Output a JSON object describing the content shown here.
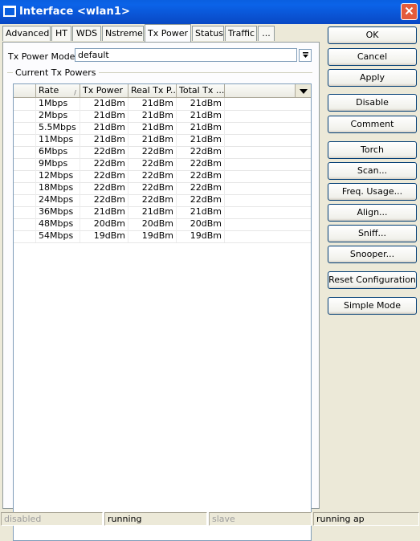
{
  "window": {
    "title": "Interface <wlan1>"
  },
  "tabs": [
    "Advanced",
    "HT",
    "WDS",
    "Nstreme",
    "Tx Power",
    "Status",
    "Traffic",
    "..."
  ],
  "tx_power_mode": {
    "label": "Tx Power Mode:",
    "value": "default"
  },
  "group": {
    "label": "Current Tx Powers"
  },
  "table": {
    "columns": [
      "Rate",
      "Tx Power",
      "Real Tx P...",
      "Total Tx ..."
    ],
    "rows": [
      [
        "1Mbps",
        "21dBm",
        "21dBm",
        "21dBm"
      ],
      [
        "2Mbps",
        "21dBm",
        "21dBm",
        "21dBm"
      ],
      [
        "5.5Mbps",
        "21dBm",
        "21dBm",
        "21dBm"
      ],
      [
        "11Mbps",
        "21dBm",
        "21dBm",
        "21dBm"
      ],
      [
        "6Mbps",
        "22dBm",
        "22dBm",
        "22dBm"
      ],
      [
        "9Mbps",
        "22dBm",
        "22dBm",
        "22dBm"
      ],
      [
        "12Mbps",
        "22dBm",
        "22dBm",
        "22dBm"
      ],
      [
        "18Mbps",
        "22dBm",
        "22dBm",
        "22dBm"
      ],
      [
        "24Mbps",
        "22dBm",
        "22dBm",
        "22dBm"
      ],
      [
        "36Mbps",
        "21dBm",
        "21dBm",
        "21dBm"
      ],
      [
        "48Mbps",
        "20dBm",
        "20dBm",
        "20dBm"
      ],
      [
        "54Mbps",
        "19dBm",
        "19dBm",
        "19dBm"
      ]
    ]
  },
  "buttons": {
    "ok": "OK",
    "cancel": "Cancel",
    "apply": "Apply",
    "disable": "Disable",
    "comment": "Comment",
    "torch": "Torch",
    "scan": "Scan...",
    "freq_usage": "Freq. Usage...",
    "align": "Align...",
    "sniff": "Sniff...",
    "snooper": "Snooper...",
    "reset_configuration": "Reset Configuration",
    "simple_mode": "Simple Mode"
  },
  "statusbar": {
    "state": "disabled",
    "running": "running",
    "role": "slave",
    "mode": "running ap"
  },
  "colors": {
    "titlebar": "#0a5fe0",
    "close_button": "#e35b3b",
    "window_bg": "#ece9d8"
  },
  "icons": {
    "title": "window-icon",
    "close": "close-icon",
    "dropdown": "dropdown-arrow-icon",
    "column_menu": "column-menu-icon",
    "sort": "sort-arrow-icon"
  }
}
